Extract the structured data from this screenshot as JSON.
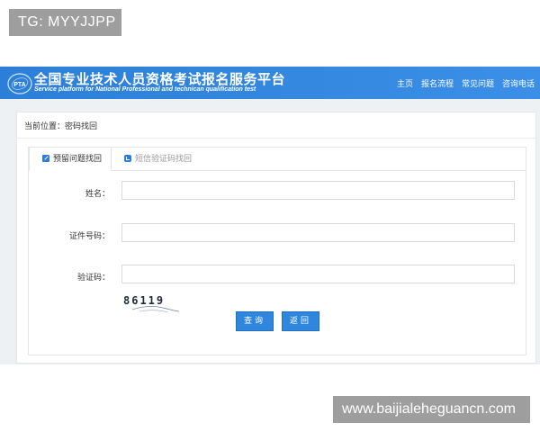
{
  "watermarks": {
    "top": "TG: MYYJJPP",
    "bottom": "www.baijialeheguancn.com"
  },
  "header": {
    "logo_text": "PTA",
    "title_cn": "全国专业技术人员资格考试报名服务平台",
    "title_en": "Service platform for National Professional and technican qualification test",
    "nav": [
      "主页",
      "报名流程",
      "常见问题",
      "咨询电话"
    ],
    "bg_color": "#2c7fd8"
  },
  "breadcrumb": "当前位置：密码找回",
  "tabs": [
    {
      "label": "预留问题找回",
      "icon": "edit-icon",
      "active": true
    },
    {
      "label": "短信验证码找回",
      "icon": "phone-icon",
      "active": false
    }
  ],
  "form": {
    "name_label": "姓名：",
    "name_value": "",
    "id_label": "证件号码：",
    "id_value": "",
    "captcha_label": "验证码：",
    "captcha_value": "",
    "captcha_image_text": "86119"
  },
  "buttons": {
    "query": "查询",
    "back": "返回",
    "color": "#2f86dd"
  }
}
